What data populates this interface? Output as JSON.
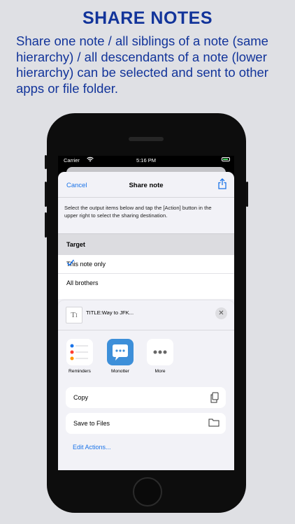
{
  "promo": {
    "headline": "SHARE NOTES",
    "description": "Share one note / all siblings of a note (same hierarchy) / all descendants of a note (lower hierarchy) can be selected and sent to other apps or file folder."
  },
  "status_bar": {
    "carrier": "Carrier",
    "time": "5:16 PM",
    "wifi_icon": "wifi-icon",
    "battery_icon": "battery-icon"
  },
  "nav": {
    "cancel_label": "Cancel",
    "title": "Share note",
    "share_icon": "share-icon"
  },
  "instructions": "Select the output items below and tap the [Action] button in the upper right to select the sharing destination.",
  "target": {
    "header": "Target",
    "options": [
      {
        "label": "This note only",
        "selected": true
      },
      {
        "label": "All brothers",
        "selected": false
      }
    ]
  },
  "share_sheet": {
    "item_title": "TITLE:Way to JFK...",
    "doc_icon": "text-document-icon",
    "close_icon": "close-icon",
    "apps": [
      {
        "label": "Reminders",
        "icon": "reminders-icon"
      },
      {
        "label": "Monotter",
        "icon": "monotter-icon"
      },
      {
        "label": "More",
        "icon": "more-icon"
      }
    ],
    "actions": [
      {
        "label": "Copy",
        "icon": "copy-icon"
      },
      {
        "label": "Save to Files",
        "icon": "folder-icon"
      }
    ],
    "edit_actions_label": "Edit Actions..."
  },
  "colors": {
    "accent": "#1a73e8",
    "headline": "#12349a",
    "monotter": "#3d8fd9"
  }
}
